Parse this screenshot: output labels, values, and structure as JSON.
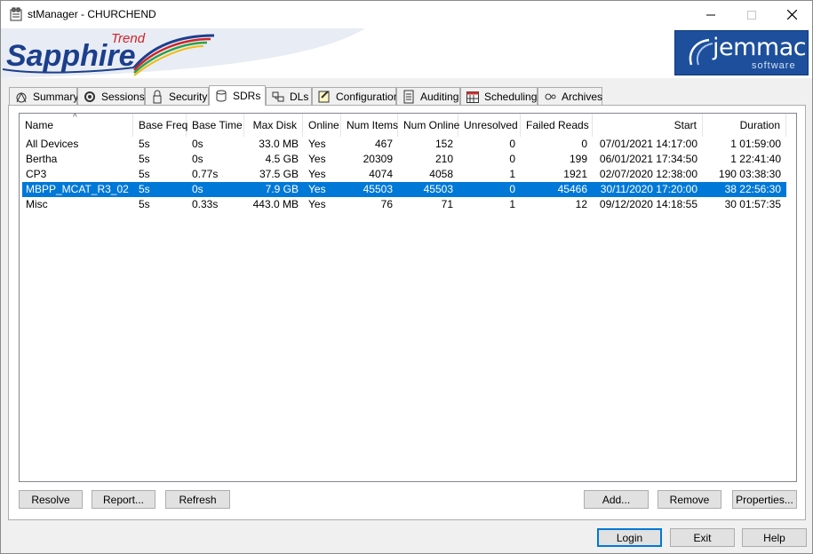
{
  "window": {
    "title": "stManager - CHURCHEND"
  },
  "banner": {
    "logo_main": "Sapphire",
    "logo_trend": "Trend",
    "brand": "jemmac",
    "brand_sub": "software"
  },
  "tabs": [
    {
      "label": "Summary",
      "icon": "summary-icon"
    },
    {
      "label": "Sessions",
      "icon": "sessions-icon"
    },
    {
      "label": "Security",
      "icon": "security-icon"
    },
    {
      "label": "SDRs",
      "icon": "database-icon",
      "active": true
    },
    {
      "label": "DLs",
      "icon": "dls-icon"
    },
    {
      "label": "Configuration",
      "icon": "configuration-icon"
    },
    {
      "label": "Auditing",
      "icon": "auditing-icon"
    },
    {
      "label": "Scheduling",
      "icon": "calendar-icon"
    },
    {
      "label": "Archives",
      "icon": "archives-icon"
    }
  ],
  "table": {
    "columns": [
      "Name",
      "Base Freq",
      "Base Time",
      "Max Disk",
      "Online",
      "Num Items",
      "Num Online",
      "Unresolved",
      "Failed Reads",
      "Start",
      "Duration"
    ],
    "rows": [
      [
        "All Devices",
        "5s",
        "0s",
        "33.0 MB",
        "Yes",
        "467",
        "152",
        "0",
        "0",
        "07/01/2021 14:17:00",
        "1 01:59:00"
      ],
      [
        "Bertha",
        "5s",
        "0s",
        "4.5 GB",
        "Yes",
        "20309",
        "210",
        "0",
        "199",
        "06/01/2021 17:34:50",
        "1 22:41:40"
      ],
      [
        "CP3",
        "5s",
        "0.77s",
        "37.5 GB",
        "Yes",
        "4074",
        "4058",
        "1",
        "1921",
        "02/07/2020 12:38:00",
        "190 03:38:30"
      ],
      [
        "MBPP_MCAT_R3_02",
        "5s",
        "0s",
        "7.9 GB",
        "Yes",
        "45503",
        "45503",
        "0",
        "45466",
        "30/11/2020 17:20:00",
        "38 22:56:30"
      ],
      [
        "Misc",
        "5s",
        "0.33s",
        "443.0 MB",
        "Yes",
        "76",
        "71",
        "1",
        "12",
        "09/12/2020 14:18:55",
        "30 01:57:35"
      ]
    ],
    "selected_row": "MBPP_MCAT_R3_02"
  },
  "panel_buttons": {
    "resolve": "Resolve",
    "report": "Report...",
    "refresh": "Refresh",
    "add": "Add...",
    "remove": "Remove",
    "properties": "Properties..."
  },
  "footer_buttons": {
    "login": "Login",
    "exit": "Exit",
    "help": "Help"
  },
  "colors": {
    "selection": "#0078d7",
    "brand_blue": "#1d4f9c"
  }
}
